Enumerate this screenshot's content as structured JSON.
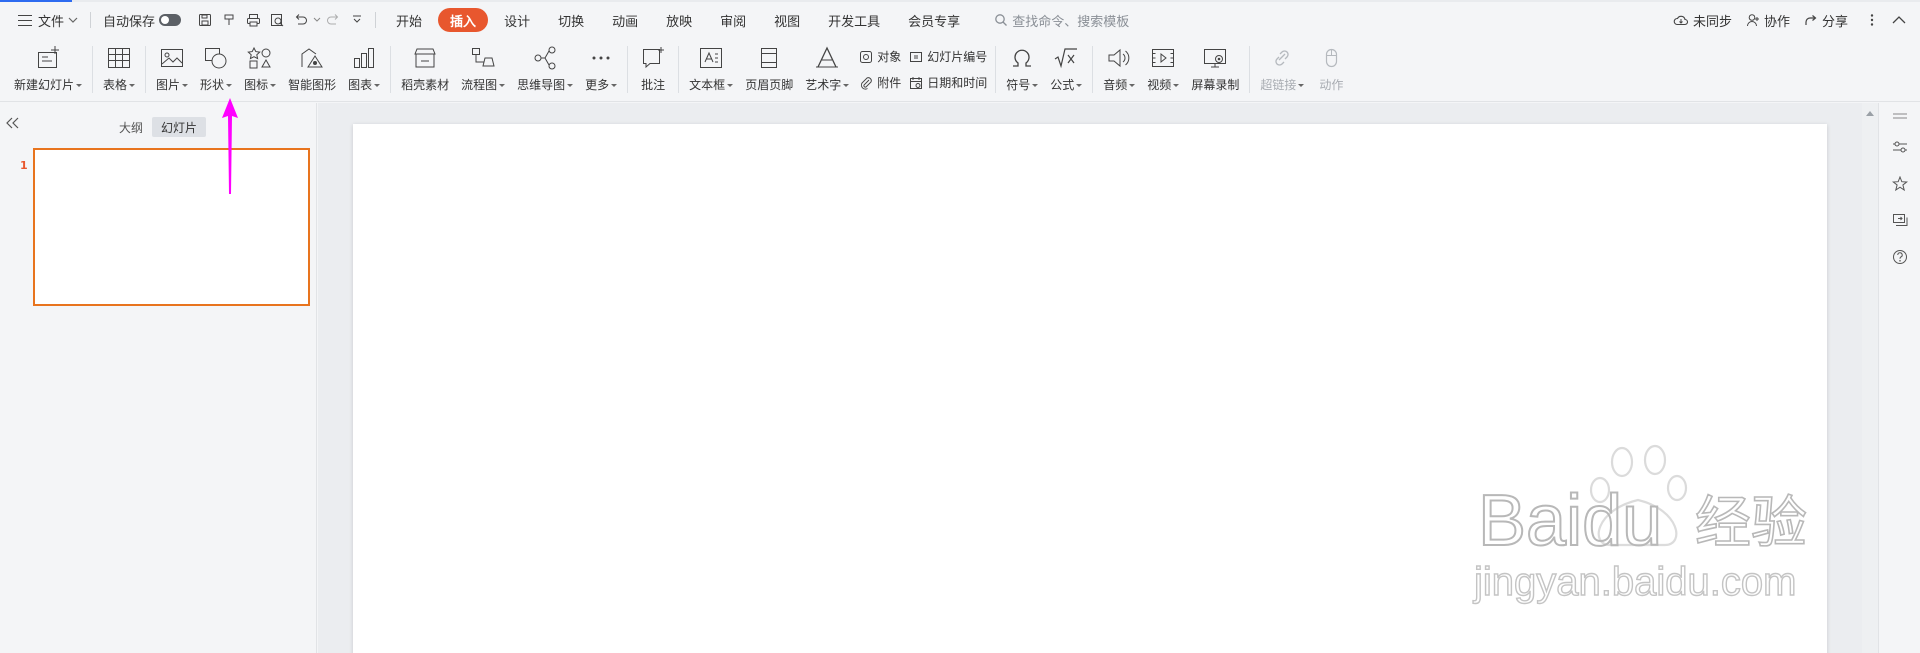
{
  "menubar": {
    "file": "文件",
    "autosave": "自动保存",
    "tabs": [
      "开始",
      "插入",
      "设计",
      "切换",
      "动画",
      "放映",
      "审阅",
      "视图",
      "开发工具",
      "会员专享"
    ],
    "active_tab_index": 1,
    "search_placeholder": "查找命令、搜索模板",
    "sync": "未同步",
    "collab": "协作",
    "share": "分享"
  },
  "ribbon": {
    "new_slide": "新建幻灯片",
    "table": "表格",
    "picture": "图片",
    "shape": "形状",
    "icon": "图标",
    "smart_graphic": "智能图形",
    "chart": "图表",
    "straw_material": "稻壳素材",
    "flowchart": "流程图",
    "mindmap": "思维导图",
    "more": "更多",
    "comment": "批注",
    "textbox": "文本框",
    "header_footer": "页眉页脚",
    "wordart": "艺术字",
    "object": "对象",
    "attachment": "附件",
    "slide_number": "幻灯片编号",
    "date_time": "日期和时间",
    "symbol": "符号",
    "formula": "公式",
    "audio": "音频",
    "video": "视频",
    "screen_record": "屏幕录制",
    "hyperlink": "超链接",
    "action": "动作"
  },
  "left_panel": {
    "tab_outline": "大纲",
    "tab_slides": "幻灯片",
    "active_tab": "幻灯片",
    "slide_numbers": [
      "1"
    ]
  },
  "watermark": {
    "brand": "Baidu",
    "cn": "经验",
    "url": "jingyan.baidu.com"
  },
  "colors": {
    "accent": "#e8572e",
    "arrow": "#ff00ff",
    "thumb_border": "#e8741e"
  }
}
